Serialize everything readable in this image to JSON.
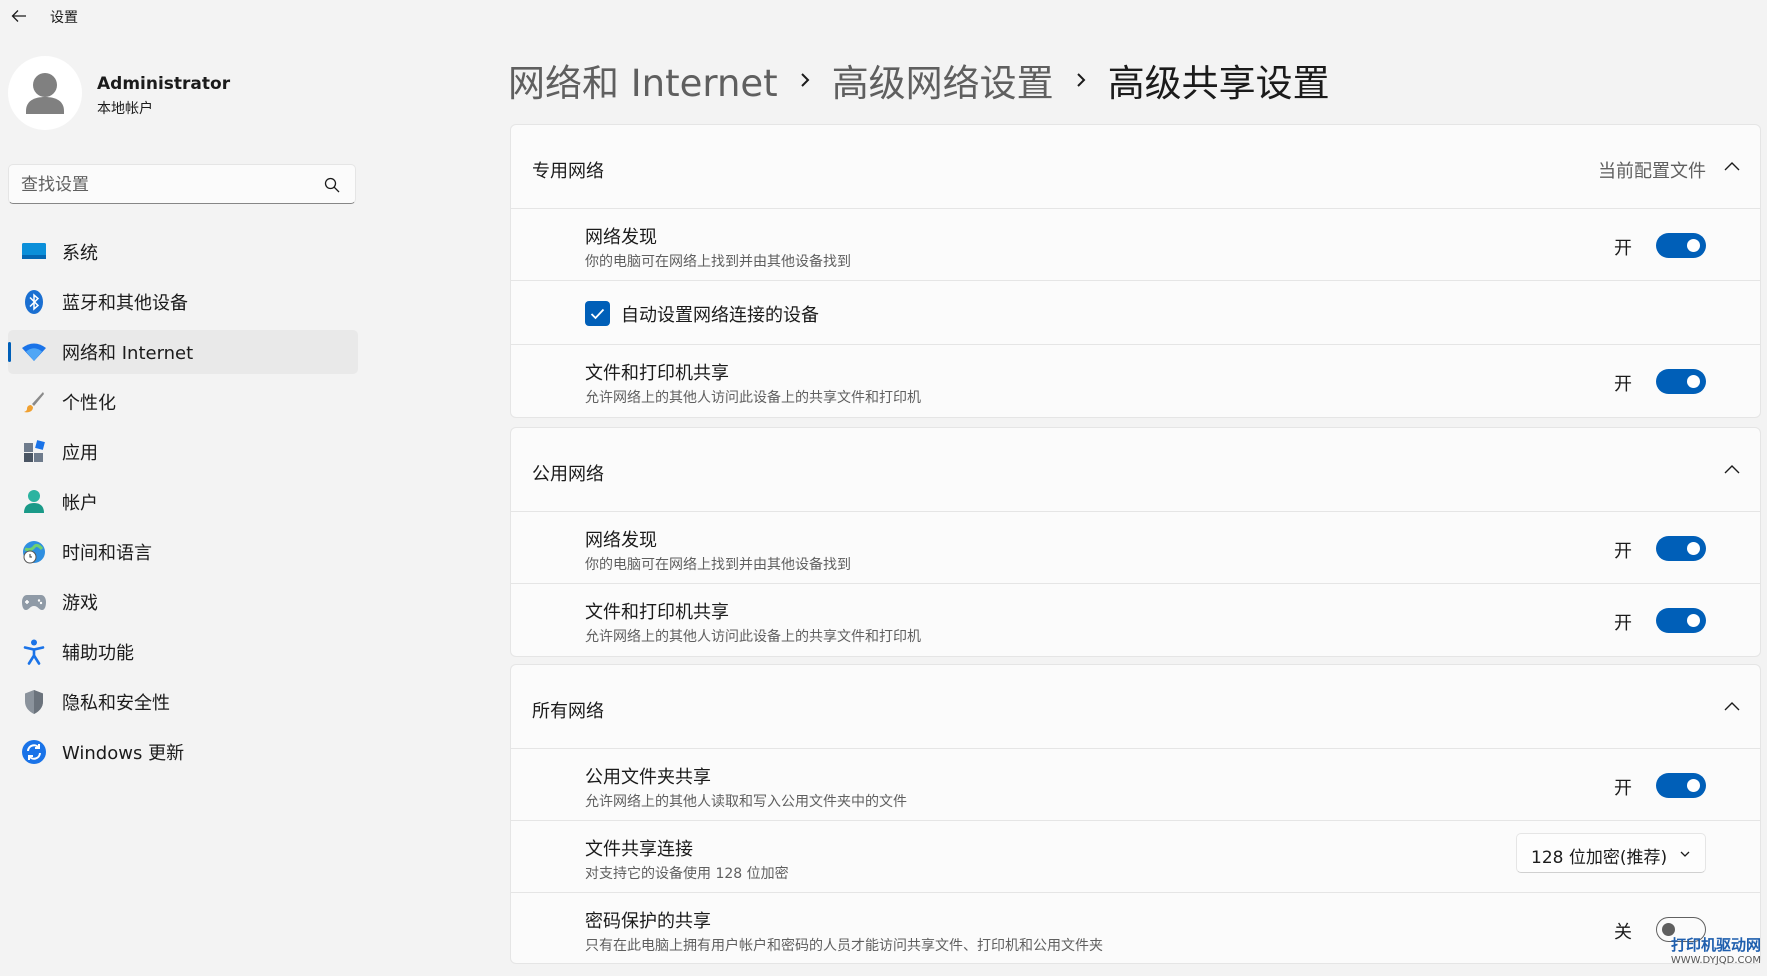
{
  "app": {
    "title": "设置"
  },
  "profile": {
    "name": "Administrator",
    "account_type": "本地帐户"
  },
  "search": {
    "placeholder": "查找设置"
  },
  "nav": {
    "items": [
      {
        "label": "系统",
        "icon": "system-icon"
      },
      {
        "label": "蓝牙和其他设备",
        "icon": "bluetooth-icon"
      },
      {
        "label": "网络和 Internet",
        "icon": "wifi-icon",
        "active": true
      },
      {
        "label": "个性化",
        "icon": "brush-icon"
      },
      {
        "label": "应用",
        "icon": "apps-icon"
      },
      {
        "label": "帐户",
        "icon": "account-icon"
      },
      {
        "label": "时间和语言",
        "icon": "globe-clock-icon"
      },
      {
        "label": "游戏",
        "icon": "gamepad-icon"
      },
      {
        "label": "辅助功能",
        "icon": "accessibility-icon"
      },
      {
        "label": "隐私和安全性",
        "icon": "shield-icon"
      },
      {
        "label": "Windows 更新",
        "icon": "update-icon"
      }
    ]
  },
  "breadcrumb": {
    "items": [
      "网络和 Internet",
      "高级网络设置",
      "高级共享设置"
    ]
  },
  "sections": {
    "private": {
      "title": "专用网络",
      "status": "当前配置文件",
      "discovery": {
        "title": "网络发现",
        "desc": "你的电脑可在网络上找到并由其他设备找到",
        "state": "开"
      },
      "auto_setup": {
        "label": "自动设置网络连接的设备",
        "checked": true
      },
      "file_sharing": {
        "title": "文件和打印机共享",
        "desc": "允许网络上的其他人访问此设备上的共享文件和打印机",
        "state": "开"
      }
    },
    "public": {
      "title": "公用网络",
      "discovery": {
        "title": "网络发现",
        "desc": "你的电脑可在网络上找到并由其他设备找到",
        "state": "开"
      },
      "file_sharing": {
        "title": "文件和打印机共享",
        "desc": "允许网络上的其他人访问此设备上的共享文件和打印机",
        "state": "开"
      }
    },
    "all": {
      "title": "所有网络",
      "public_folder": {
        "title": "公用文件夹共享",
        "desc": "允许网络上的其他人读取和写入公用文件夹中的文件",
        "state": "开"
      },
      "connection": {
        "title": "文件共享连接",
        "desc": "对支持它的设备使用 128 位加密",
        "selected": "128 位加密(推荐)"
      },
      "password": {
        "title": "密码保护的共享",
        "desc": "只有在此电脑上拥有用户帐户和密码的人员才能访问共享文件、打印机和公用文件夹",
        "state": "关"
      }
    }
  },
  "watermark": {
    "main": "打印机驱动网",
    "sub": "WWW.DYJQD.COM"
  },
  "colors": {
    "accent": "#005fb8",
    "background": "#f3f3f3",
    "card": "#fbfbfb"
  }
}
